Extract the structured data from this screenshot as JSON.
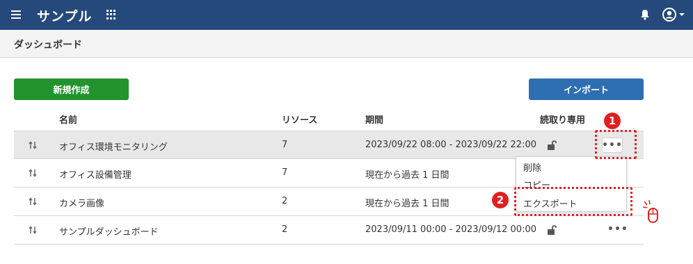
{
  "header": {
    "app_title": "サンプル",
    "icons": [
      "hamburger-icon",
      "apps-grid-icon",
      "bell-icon",
      "user-icon",
      "caret-down-icon"
    ],
    "color": "#24497a"
  },
  "page": {
    "title": "ダッシュボード"
  },
  "toolbar": {
    "new_label": "新規作成",
    "import_label": "インポート"
  },
  "table": {
    "columns": {
      "name": "名前",
      "resources": "リソース",
      "period": "期間",
      "readonly": "読取り専用"
    },
    "rows": [
      {
        "name": "オフィス環境モニタリング",
        "resources": "7",
        "period": "2023/09/22 08:00 - 2023/09/22 22:00",
        "locked": true
      },
      {
        "name": "オフィス設備管理",
        "resources": "7",
        "period": "現在から過去 1 日間",
        "locked": false
      },
      {
        "name": "カメラ画像",
        "resources": "2",
        "period": "現在から過去 1 日間",
        "locked": false
      },
      {
        "name": "サンプルダッシュボード",
        "resources": "2",
        "period": "2023/09/11 00:00 - 2023/09/12 00:00",
        "locked": true
      }
    ]
  },
  "menu": {
    "delete": "削除",
    "copy": "コピー",
    "export": "エクスポート"
  },
  "callouts": {
    "one": "1",
    "two": "2"
  }
}
